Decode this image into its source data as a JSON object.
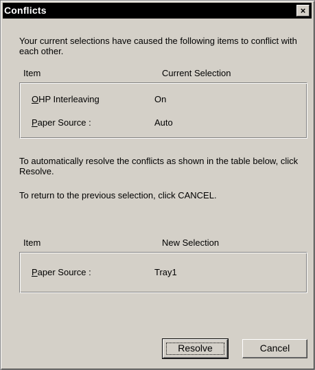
{
  "dialog": {
    "title": "Conflicts",
    "close_glyph": "×",
    "intro": "Your current selections have caused the following items to conflict with each other.",
    "current_table": {
      "header_item": "Item",
      "header_value": "Current Selection",
      "rows": [
        {
          "item_mnemonic": "O",
          "item_rest": "HP Interleaving",
          "value": "On"
        },
        {
          "item_mnemonic": "P",
          "item_rest": "aper Source :",
          "value": "Auto"
        }
      ]
    },
    "resolve_text": "To automatically resolve the conflicts as shown in the table below, click Resolve.",
    "cancel_text": "To return to the previous selection, click CANCEL.",
    "new_table": {
      "header_item": "Item",
      "header_value": "New Selection",
      "rows": [
        {
          "item_mnemonic": "P",
          "item_rest": "aper Source :",
          "value": "Tray1"
        }
      ]
    },
    "buttons": {
      "resolve": "Resolve",
      "cancel": "Cancel"
    }
  }
}
